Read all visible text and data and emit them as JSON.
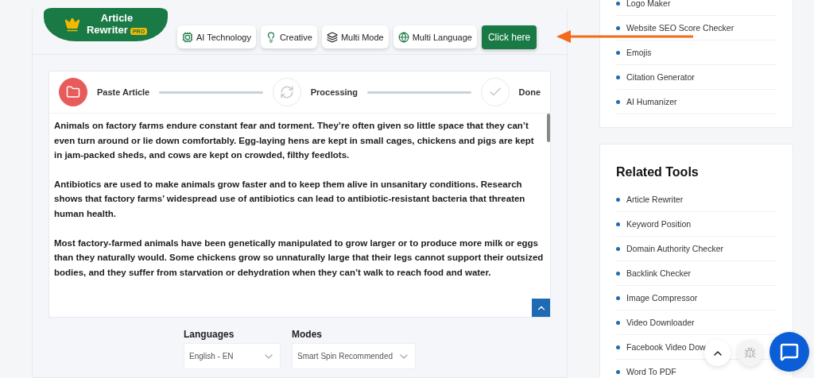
{
  "tool_header": {
    "title": "Article Rewriter",
    "badge": "PRO"
  },
  "features": [
    {
      "label": "AI Technology",
      "kind": "chip"
    },
    {
      "label": "Creative",
      "kind": "bulb"
    },
    {
      "label": "Multi Mode",
      "kind": "modes"
    },
    {
      "label": "Multi Language",
      "kind": "globe"
    }
  ],
  "cta_button": "Click here",
  "steps": [
    {
      "label": "Paste Article",
      "kind": "folder",
      "active": true
    },
    {
      "label": "Processing",
      "kind": "gear",
      "active": false
    },
    {
      "label": "Done",
      "kind": "check",
      "active": false
    }
  ],
  "article_text": [
    "Animals on factory farms endure constant fear and torment. They’re often given so little space that they can’t even turn around or lie down comfortably. Egg-laying hens are kept in small cages, chickens and pigs are kept in jam-packed sheds, and cows are kept on crowded, filthy feedlots.",
    "Antibiotics are used to make animals grow faster and to keep them alive in unsanitary conditions. Research shows that factory farms’ widespread use of antibiotics can lead to antibiotic-resistant bacteria that threaten human health.",
    "Most factory-farmed animals have been genetically manipulated to grow larger or to produce more milk or eggs than they naturally would. Some chickens grow so unnaturally large that their legs cannot support their outsized bodies, and they suffer from starvation or dehydration when they can’t walk to reach food and water."
  ],
  "selects": [
    {
      "label": "Languages",
      "value": "English - EN"
    },
    {
      "label": "Modes",
      "value": "Smart Spin Recommended"
    }
  ],
  "sidebar": {
    "top_links": [
      "Logo Maker",
      "Website SEO Score Checker",
      "Emojis",
      "Citation Generator",
      "AI Humanizer"
    ],
    "related_tools": {
      "title": "Related Tools",
      "links": [
        "Article Rewriter",
        "Keyword Position",
        "Domain Authority Checker",
        "Backlink Checker",
        "Image Compressor",
        "Video Downloader",
        "Facebook Video Dow",
        "Word To PDF"
      ]
    }
  }
}
